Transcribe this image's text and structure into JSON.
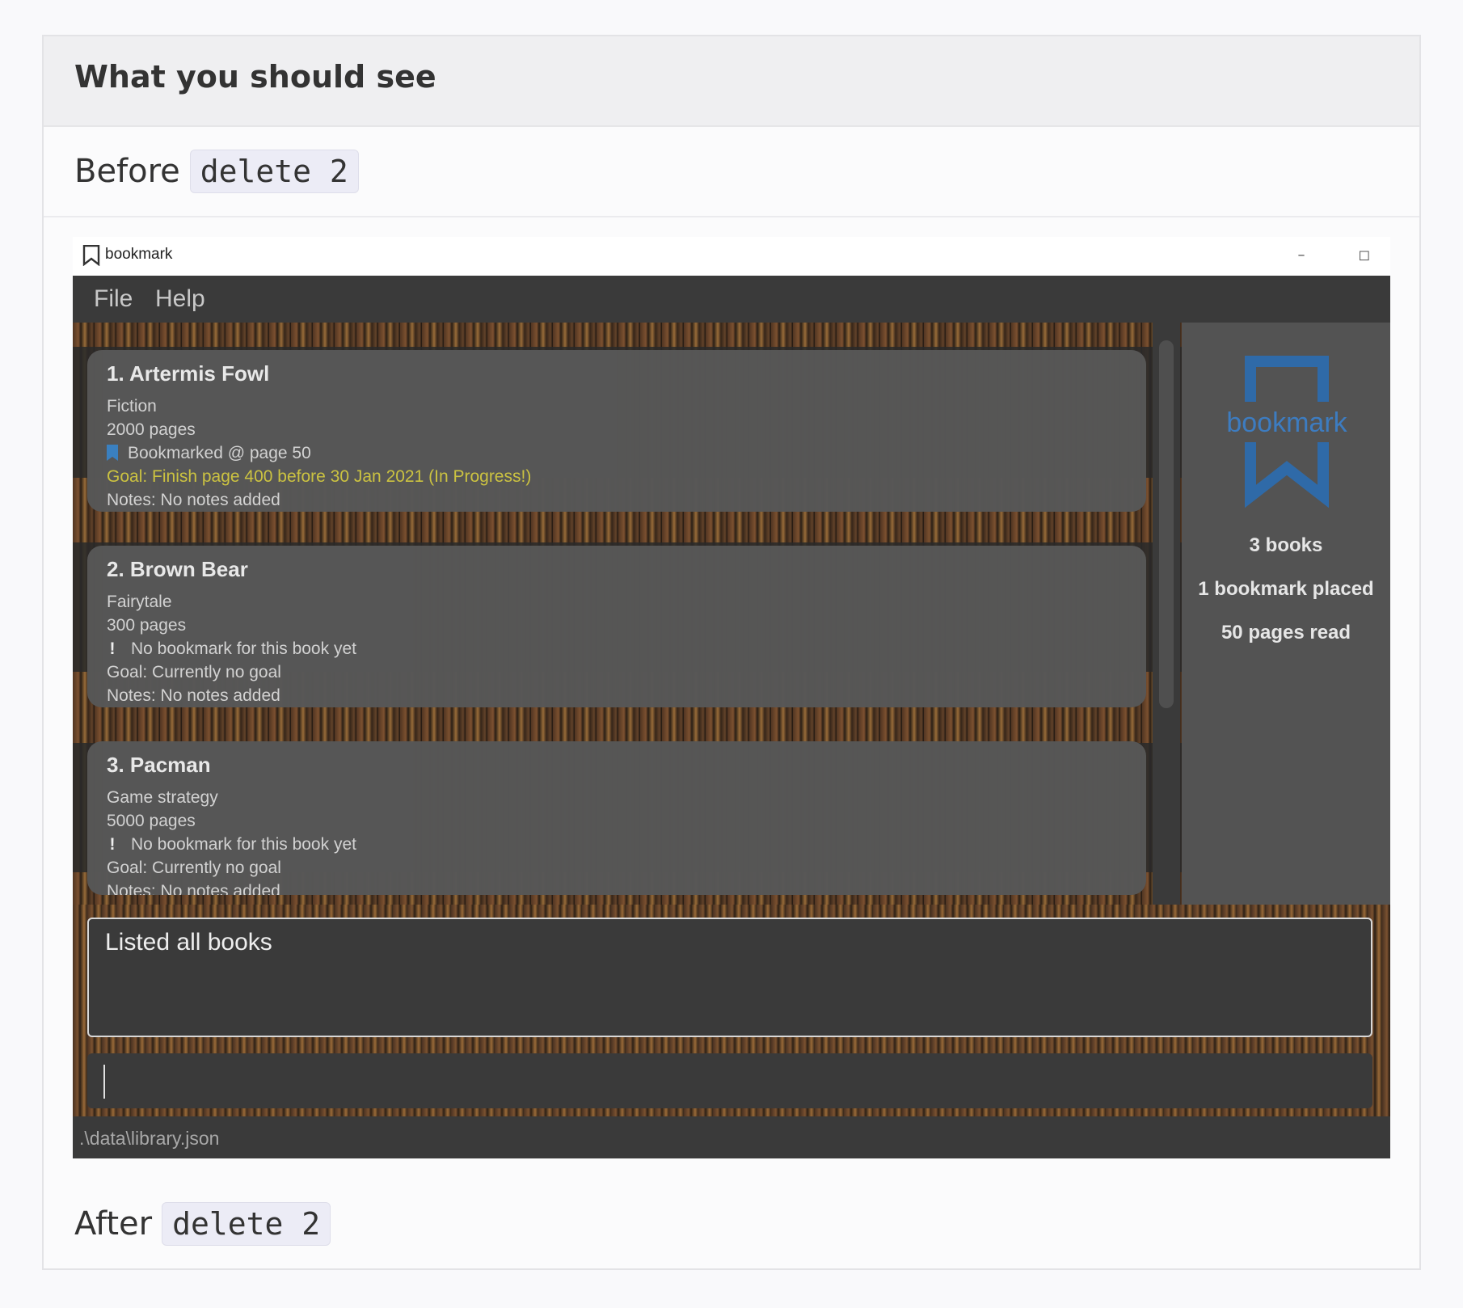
{
  "doc": {
    "heading": "What you should see",
    "before_label": "Before",
    "after_label": "After",
    "command": "delete 2"
  },
  "window": {
    "title": "bookmark",
    "controls": {
      "minimize": "–",
      "maximize": "◻",
      "close": "✕"
    }
  },
  "menu": {
    "file": "File",
    "help": "Help"
  },
  "books": [
    {
      "title": "1.  Artermis Fowl",
      "genre": "Fiction",
      "pages": "2000 pages",
      "bookmark": "Bookmarked @ page 50",
      "bookmark_icon": "bookmark-flag-icon",
      "goal": "Goal: Finish page 400 before 30 Jan 2021 (In Progress!)",
      "notes": "Notes: No notes added"
    },
    {
      "title": "2.  Brown Bear",
      "genre": "Fairytale",
      "pages": "300 pages",
      "bookmark": "No bookmark for this book yet",
      "bookmark_icon": "exclamation-icon",
      "goal": "Goal: Currently no goal",
      "notes": "Notes: No notes added"
    },
    {
      "title": "3.  Pacman",
      "genre": "Game strategy",
      "pages": "5000 pages",
      "bookmark": "No bookmark for this book yet",
      "bookmark_icon": "exclamation-icon",
      "goal": "Goal: Currently no goal",
      "notes": "Notes: No notes added"
    }
  ],
  "sidebar": {
    "logo_text": "bookmark",
    "books_count": "3 books",
    "bookmarks_placed": "1 bookmark placed",
    "pages_read": "50 pages read"
  },
  "result": {
    "text": "Listed all books"
  },
  "command_box": {
    "value": ""
  },
  "status": {
    "path": ".\\data\\library.json"
  },
  "colors": {
    "goal_in_progress": "#cfc642",
    "logo_blue": "#2f6aa8",
    "card_bg": "#575757"
  }
}
